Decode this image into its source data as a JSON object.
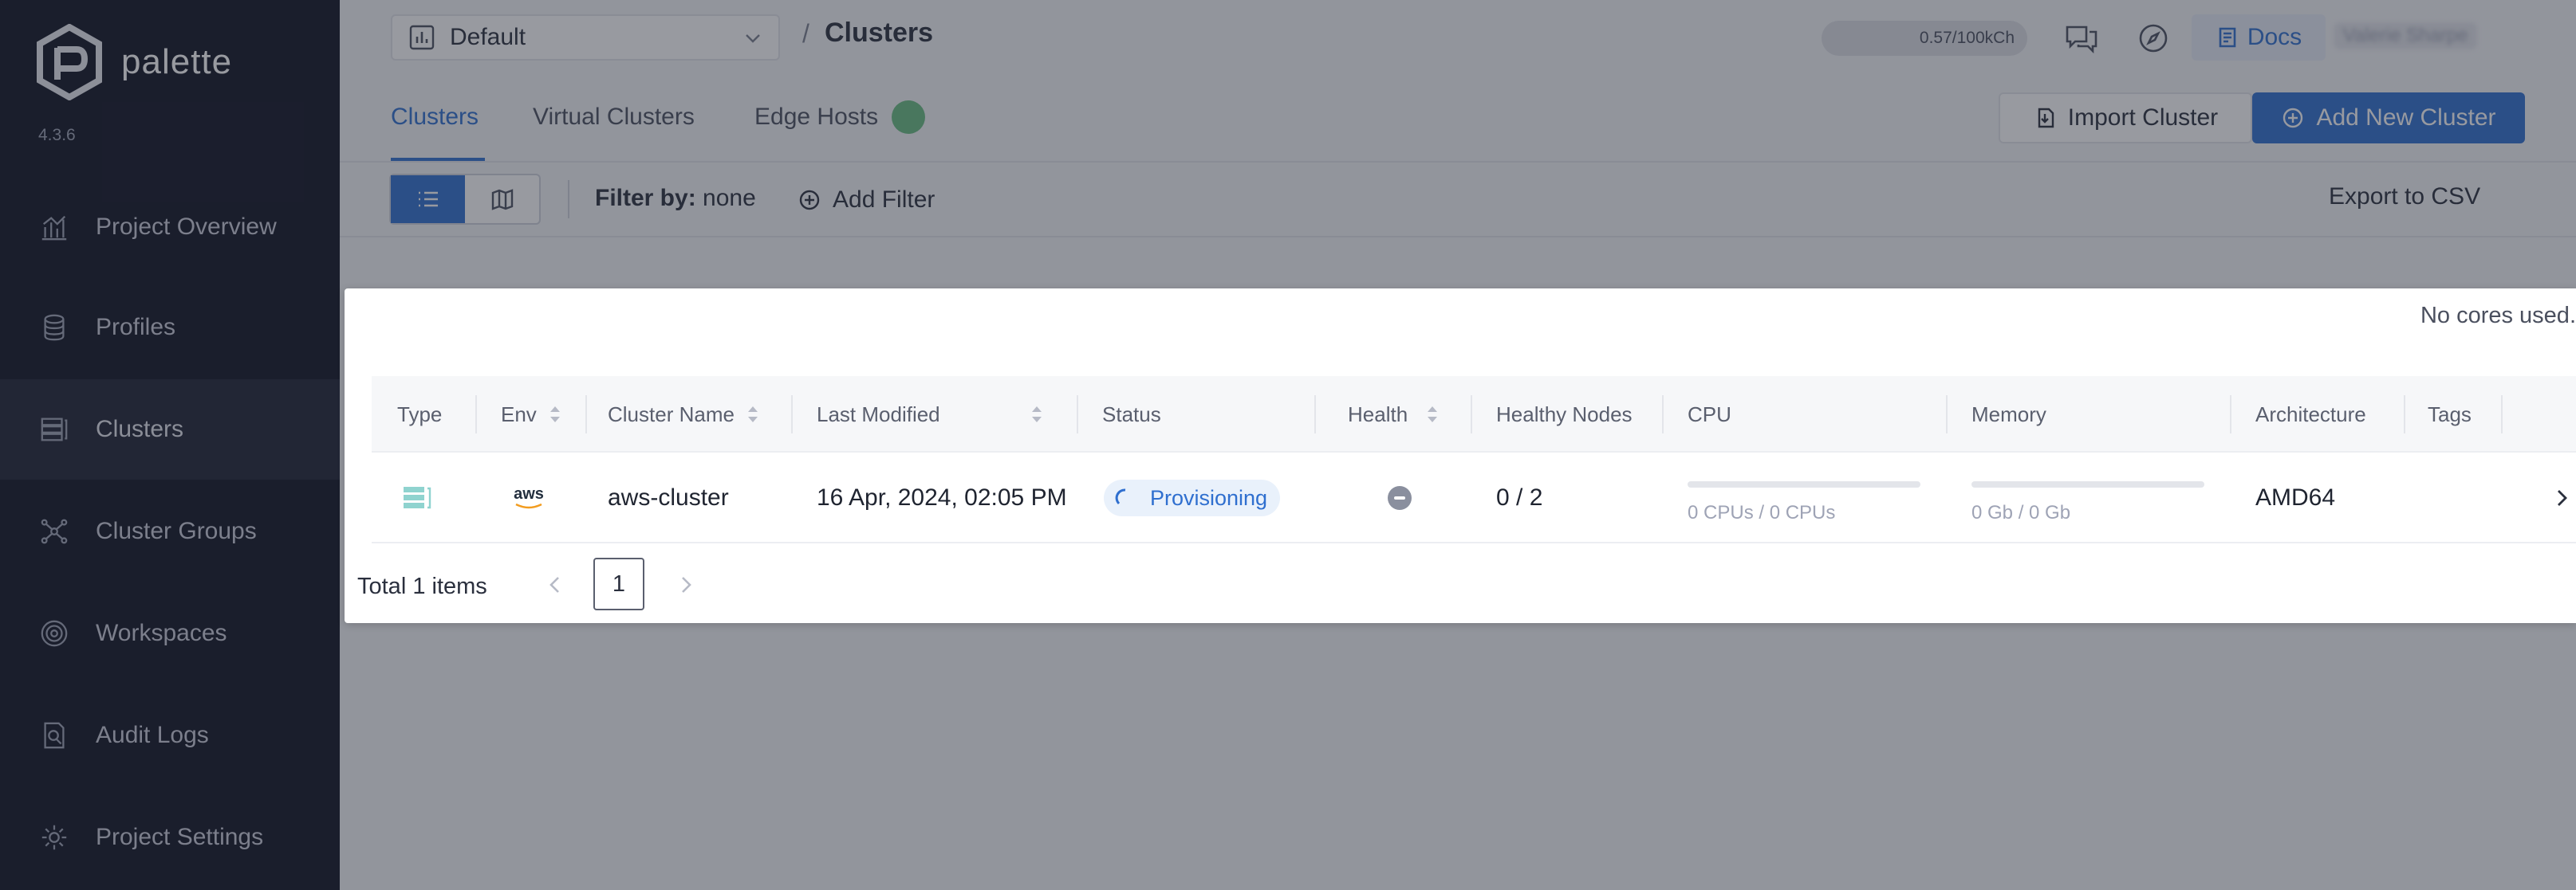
{
  "app": {
    "name": "palette",
    "version": "4.3.6"
  },
  "sidebar": {
    "items": [
      {
        "label": "Project Overview",
        "icon": "chart-icon"
      },
      {
        "label": "Profiles",
        "icon": "stack-icon"
      },
      {
        "label": "Clusters",
        "icon": "clusters-icon",
        "active": true
      },
      {
        "label": "Cluster Groups",
        "icon": "nodes-icon"
      },
      {
        "label": "Workspaces",
        "icon": "target-icon"
      },
      {
        "label": "Audit Logs",
        "icon": "audit-icon"
      },
      {
        "label": "Project Settings",
        "icon": "gear-icon"
      }
    ]
  },
  "header": {
    "project": "Default",
    "separator": "/",
    "title": "Clusters",
    "usage": "0.57/100kCh",
    "docs_label": "Docs",
    "user_name": "Valerie Sharpe"
  },
  "tabs": [
    {
      "label": "Clusters",
      "active": true
    },
    {
      "label": "Virtual Clusters"
    },
    {
      "label": "Edge Hosts"
    }
  ],
  "actions": {
    "import_label": "Import Cluster",
    "add_label": "Add New Cluster"
  },
  "filter": {
    "prefix": "Filter by:",
    "value": "none",
    "add_label": "Add Filter",
    "export_label": "Export to CSV"
  },
  "card": {
    "cores_note": "No cores used."
  },
  "table": {
    "headers": [
      "Type",
      "Env",
      "Cluster Name",
      "Last Modified",
      "Status",
      "Health",
      "Healthy Nodes",
      "CPU",
      "Memory",
      "Architecture",
      "Tags"
    ],
    "rows": [
      {
        "type_icon": "cluster-type-icon",
        "env": "aws",
        "name": "aws-cluster",
        "last_modified": "16 Apr, 2024, 02:05 PM",
        "status": "Provisioning",
        "healthy_nodes": "0 / 2",
        "cpu": "0 CPUs / 0 CPUs",
        "cpu_usage": 0,
        "memory": "0 Gb / 0 Gb",
        "memory_usage": 0,
        "architecture": "AMD64",
        "tags": ""
      }
    ]
  },
  "pagination": {
    "total": "Total 1 items",
    "page": "1"
  },
  "colors": {
    "accent": "#2f6fcf",
    "sidebar_bg": "#0f1222",
    "healthy_badge": "#2ea44f"
  }
}
